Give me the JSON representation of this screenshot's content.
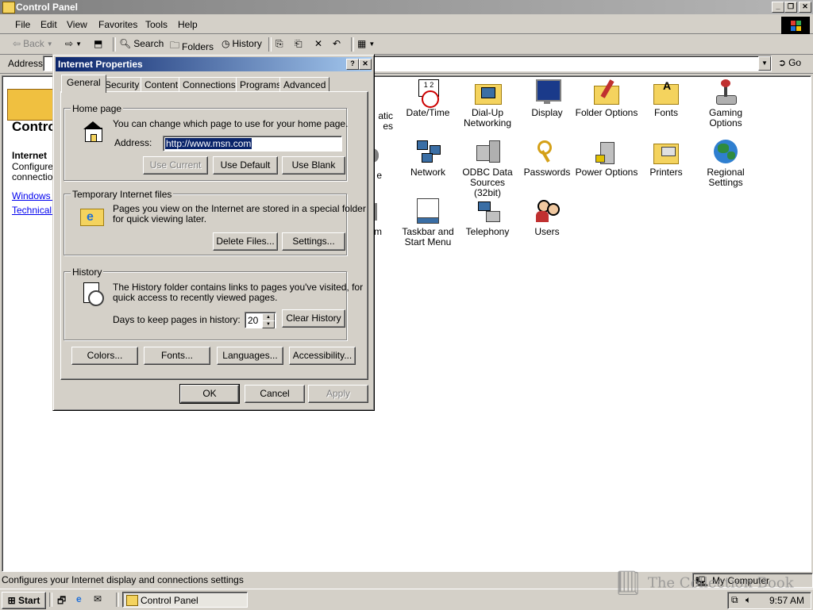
{
  "window": {
    "title": "Control Panel"
  },
  "menu": {
    "items": [
      "File",
      "Edit",
      "View",
      "Favorites",
      "Tools",
      "Help"
    ]
  },
  "toolbar": {
    "back": "Back",
    "search": "Search",
    "folders": "Folders",
    "history": "History"
  },
  "addressbar": {
    "label": "Address",
    "go": "Go"
  },
  "leftpanel": {
    "title": "Contro",
    "heading": "Internet",
    "desc_line1": "Configures",
    "desc_line2": "connection",
    "link1": "Windows U",
    "link2": "Technical S"
  },
  "icons": [
    {
      "label1": "atic",
      "label2": "es",
      "icon": "partially-hidden-icon"
    },
    {
      "label1": "Date/Time",
      "label2": "",
      "icon": "calendar-clock-icon"
    },
    {
      "label1": "Dial-Up",
      "label2": "Networking",
      "icon": "dialup-folder-icon"
    },
    {
      "label1": "Display",
      "label2": "",
      "icon": "monitor-icon"
    },
    {
      "label1": "Folder Options",
      "label2": "",
      "icon": "folder-options-icon"
    },
    {
      "label1": "Fonts",
      "label2": "",
      "icon": "fonts-folder-icon"
    },
    {
      "label1": "Gaming",
      "label2": "Options",
      "icon": "joystick-icon"
    },
    {
      "label1": "e",
      "label2": "",
      "icon": "partially-hidden-icon"
    },
    {
      "label1": "Network",
      "label2": "",
      "icon": "network-icon"
    },
    {
      "label1": "ODBC Data",
      "label2": "Sources (32bit)",
      "icon": "odbc-icon"
    },
    {
      "label1": "Passwords",
      "label2": "",
      "icon": "keys-icon"
    },
    {
      "label1": "Power Options",
      "label2": "",
      "icon": "power-icon"
    },
    {
      "label1": "Printers",
      "label2": "",
      "icon": "printers-folder-icon"
    },
    {
      "label1": "Regional",
      "label2": "Settings",
      "icon": "globe-icon"
    },
    {
      "label1": "m",
      "label2": "",
      "icon": "partially-hidden-icon"
    },
    {
      "label1": "Taskbar and",
      "label2": "Start Menu",
      "icon": "taskbar-icon"
    },
    {
      "label1": "Telephony",
      "label2": "",
      "icon": "telephony-icon"
    },
    {
      "label1": "Users",
      "label2": "",
      "icon": "users-icon"
    }
  ],
  "status": {
    "text": "Configures your Internet display and connections settings",
    "zone": "My Computer"
  },
  "taskbar": {
    "start": "Start",
    "task": "Control Panel",
    "clock": "9:57 AM"
  },
  "dialog": {
    "title": "Internet Properties",
    "tabs": [
      "General",
      "Security",
      "Content",
      "Connections",
      "Programs",
      "Advanced"
    ],
    "home": {
      "legend": "Home page",
      "text": "You can change which page to use for your home page.",
      "address_label": "Address:",
      "address_value": "http://www.msn.com",
      "use_current": "Use Current",
      "use_default": "Use Default",
      "use_blank": "Use Blank"
    },
    "temp": {
      "legend": "Temporary Internet files",
      "line1": "Pages you view on the Internet are stored in a special folder",
      "line2": "for quick viewing later.",
      "delete": "Delete Files...",
      "settings": "Settings..."
    },
    "history": {
      "legend": "History",
      "line1": "The History folder contains links to pages you've visited, for",
      "line2": "quick access to recently viewed pages.",
      "days_label": "Days to keep pages in history:",
      "days_value": "20",
      "clear": "Clear History"
    },
    "buttons": {
      "colors": "Colors...",
      "fonts": "Fonts...",
      "languages": "Languages...",
      "accessibility": "Accessibility...",
      "ok": "OK",
      "cancel": "Cancel",
      "apply": "Apply"
    }
  },
  "watermark": "The Collection Book"
}
